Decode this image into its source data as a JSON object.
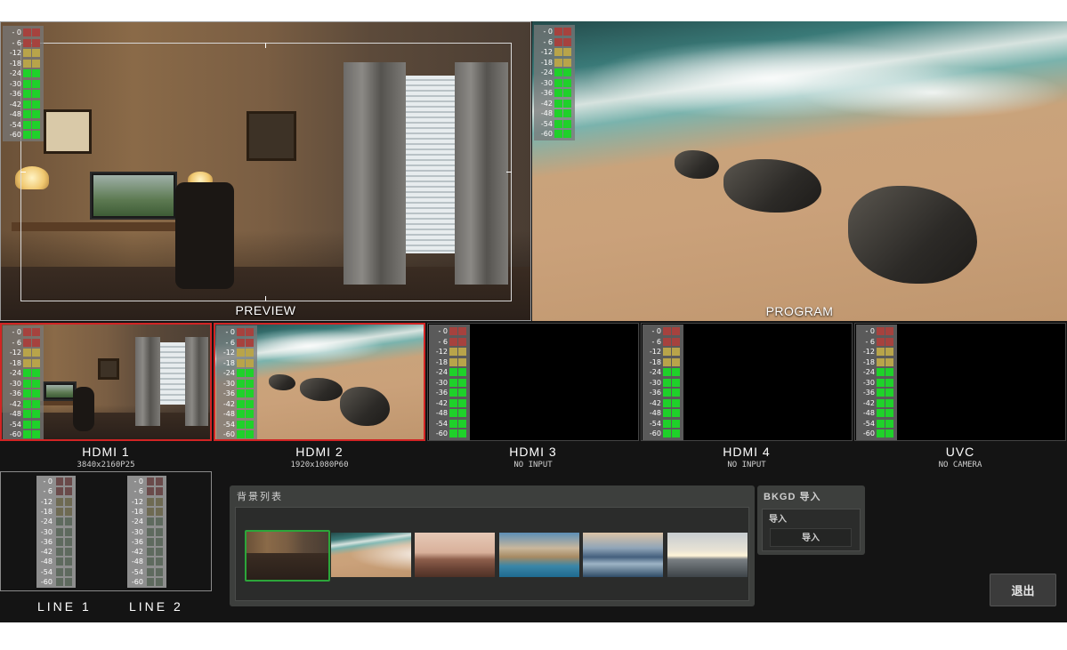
{
  "meter_scale": [
    "- 0",
    "- 6",
    "-12",
    "-18",
    "-24",
    "-30",
    "-36",
    "-42",
    "-48",
    "-54",
    "-60"
  ],
  "monitors": {
    "preview_label": "PREVIEW",
    "program_label": "PROGRAM"
  },
  "sources": [
    {
      "name": "HDMI  1",
      "info": "3840x2160P25",
      "scene": "room",
      "active": true
    },
    {
      "name": "HDMI  2",
      "info": "1920x1080P60",
      "scene": "beach",
      "active": true
    },
    {
      "name": "HDMI  3",
      "info": "NO INPUT",
      "scene": "none",
      "active": false
    },
    {
      "name": "HDMI  4",
      "info": "NO INPUT",
      "scene": "none",
      "active": false
    },
    {
      "name": "UVC",
      "info": "NO CAMERA",
      "scene": "none",
      "active": false
    }
  ],
  "lines": [
    {
      "name": "LINE 1"
    },
    {
      "name": "LINE 2"
    }
  ],
  "background_list": {
    "title": "背景列表",
    "thumbnails": [
      "room",
      "beach",
      "desert",
      "cove",
      "harbor",
      "bridge"
    ],
    "selected_index": 0
  },
  "bkgd": {
    "title": "BKGD 导入",
    "subtitle": "导入",
    "button_label": "导入"
  },
  "exit_label": "退出",
  "colors": {
    "meter_green": "#1fd12a",
    "meter_yellow": "#b8a44a",
    "meter_red": "#a6423e",
    "active_border": "#d22424",
    "selected_border": "#2ca63a"
  }
}
